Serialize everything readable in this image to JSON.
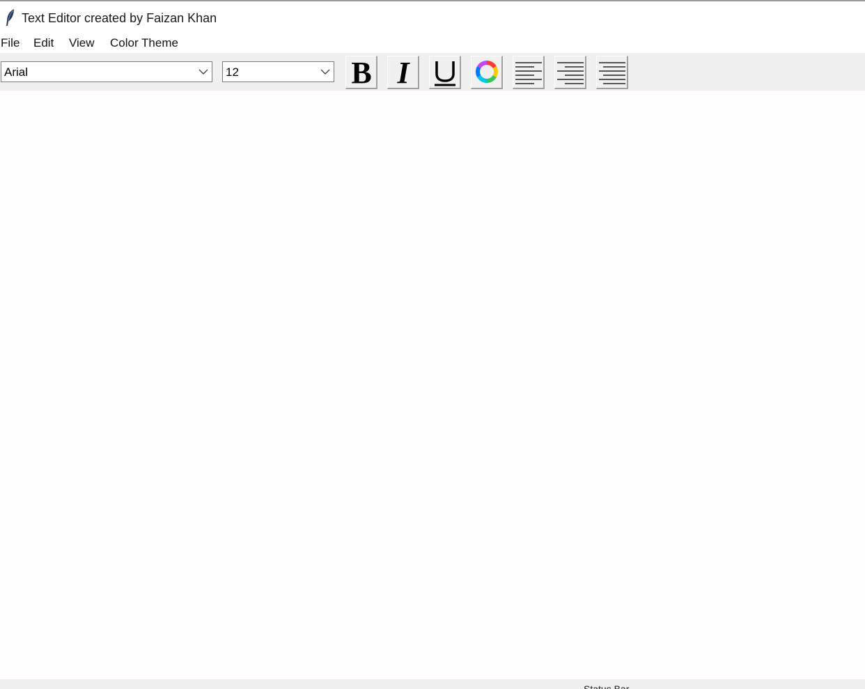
{
  "window": {
    "title": "Text Editor created by Faizan Khan",
    "icon": "feather-icon"
  },
  "menubar": {
    "items": [
      {
        "label": "File"
      },
      {
        "label": "Edit"
      },
      {
        "label": "View"
      },
      {
        "label": "Color Theme"
      }
    ]
  },
  "toolbar": {
    "font_family": {
      "value": "Arial"
    },
    "font_size": {
      "value": "12"
    },
    "buttons": [
      {
        "name": "bold",
        "icon": "bold-icon"
      },
      {
        "name": "italic",
        "icon": "italic-icon"
      },
      {
        "name": "underline",
        "icon": "underline-icon"
      },
      {
        "name": "font-color",
        "icon": "color-wheel-icon"
      },
      {
        "name": "align-left",
        "icon": "align-left-icon"
      },
      {
        "name": "align-center",
        "icon": "align-center-icon"
      },
      {
        "name": "align-right",
        "icon": "align-right-icon"
      }
    ]
  },
  "editor": {
    "content": ""
  },
  "statusbar": {
    "text": "Status Bar"
  },
  "colors": {
    "toolbar_bg": "#f0f0f0",
    "editor_bg": "#fffdfe",
    "statusbar_bg": "#efefef"
  }
}
